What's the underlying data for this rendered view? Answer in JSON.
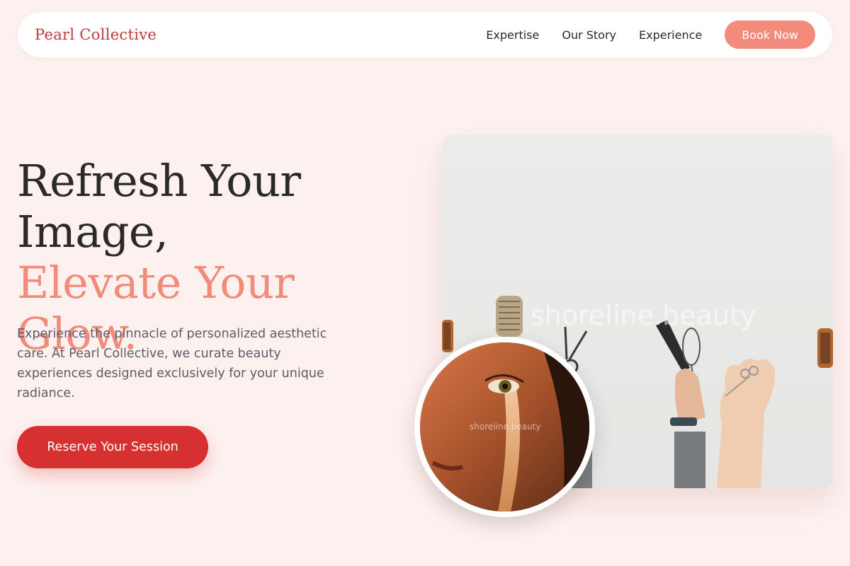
{
  "brand": {
    "name": "Pearl Collective"
  },
  "nav": {
    "links": [
      "Expertise",
      "Our Story",
      "Experience"
    ],
    "cta_label": "Book Now"
  },
  "hero": {
    "title_line1": "Refresh Your",
    "title_line2": "Image,",
    "title_accent": "Elevate Your Glow.",
    "description": "Experience the pinnacle of personalized aesthetic care. At Pearl Collective, we curate beauty experiences designed exclusively for your unique radiance.",
    "cta_label": "Reserve Your Session"
  },
  "images": {
    "main_watermark": "shoreline.beauty",
    "circle_watermark": "shoreline.beauty"
  },
  "colors": {
    "background": "#fdf1ef",
    "accent": "#f28b7c",
    "brand": "#c23a3a",
    "primary_button": "#d63030"
  }
}
